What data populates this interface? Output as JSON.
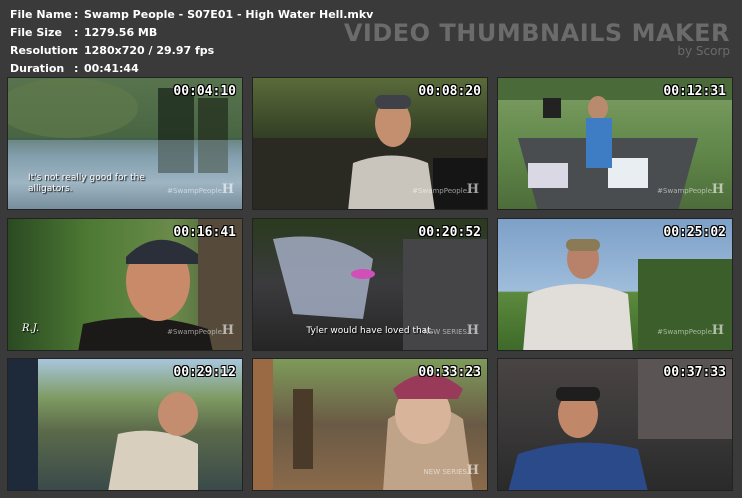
{
  "info": {
    "file_name_label": "File Name",
    "file_name": "Swamp People - S07E01 - High Water Hell.mkv",
    "file_size_label": "File Size",
    "file_size": "1279.56 MB",
    "resolution_label": "Resolution",
    "resolution": "1280x720 / 29.97 fps",
    "duration_label": "Duration",
    "duration": "00:41:44",
    "colon": ":"
  },
  "brand": {
    "title": "VIDEO THUMBNAILS MAKER",
    "subtitle": "by Scorp"
  },
  "thumbs": [
    {
      "time": "00:04:10",
      "caption": "It's not really good for the\nalligators.",
      "bug": "#SwampPeople"
    },
    {
      "time": "00:08:20",
      "bug": "#SwampPeople"
    },
    {
      "time": "00:12:31",
      "bug": "#SwampPeople"
    },
    {
      "time": "00:16:41",
      "bug": "#SwampPeople",
      "name_tag": "R.J."
    },
    {
      "time": "00:20:52",
      "caption": "Tyler would have loved that.",
      "bug": "NEW SERIES"
    },
    {
      "time": "00:25:02",
      "bug": "#SwampPeople"
    },
    {
      "time": "00:29:12"
    },
    {
      "time": "00:33:23",
      "bug": "NEW SERIES"
    },
    {
      "time": "00:37:33"
    }
  ],
  "colors": {
    "background": "#3a3a3a",
    "text": "#ffffff",
    "brand": "#6b6b6b"
  }
}
